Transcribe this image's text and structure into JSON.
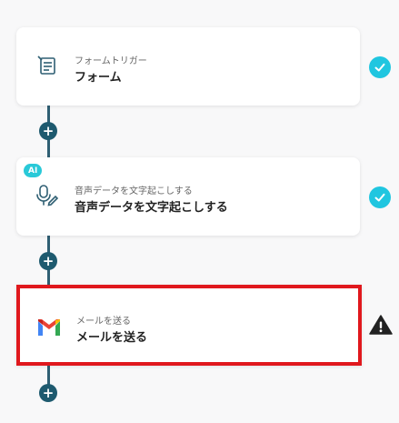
{
  "steps": [
    {
      "subtitle": "フォームトリガー",
      "title": "フォーム",
      "status": "complete",
      "icon": "form-icon"
    },
    {
      "subtitle": "音声データを文字起こしする",
      "title": "音声データを文字起こしする",
      "status": "complete",
      "icon": "microphone-icon",
      "badge": "AI"
    },
    {
      "subtitle": "メールを送る",
      "title": "メールを送る",
      "status": "warning",
      "icon": "gmail-icon"
    }
  ],
  "add_step_symbol": "+",
  "colors": {
    "check": "#20c6e0",
    "connector": "#1e5a6f",
    "selection": "#e0181d"
  }
}
